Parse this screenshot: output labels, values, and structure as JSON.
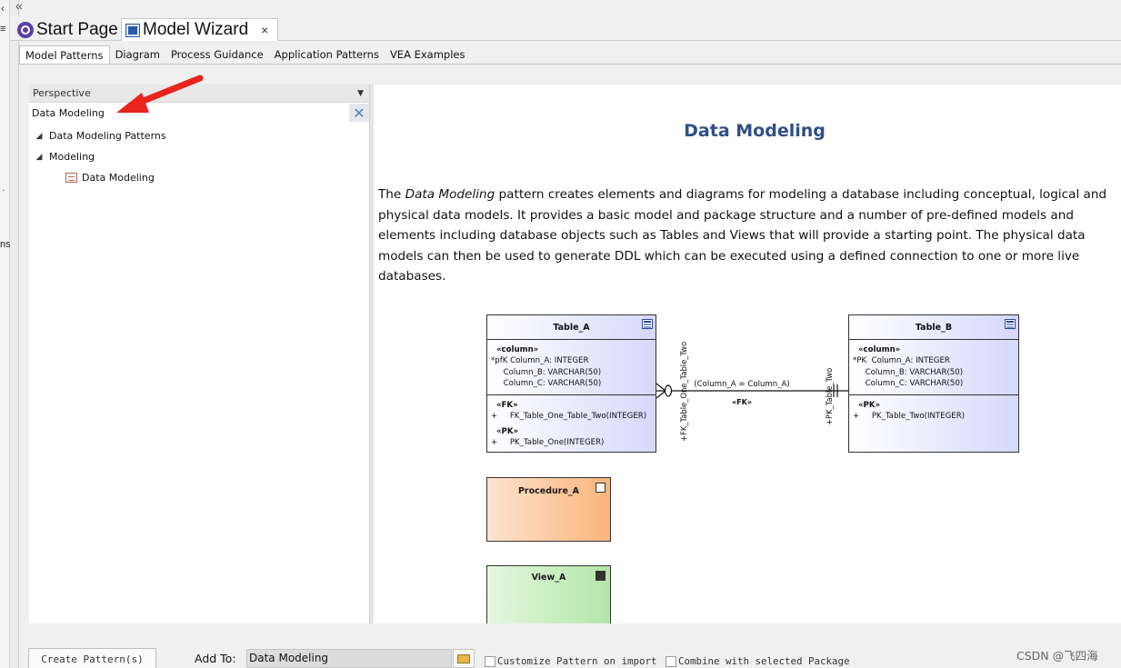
{
  "left_strip": {
    "chevron": "‹",
    "menu": "≡",
    "dot": "·",
    "fragment": "ns"
  },
  "topbar": {
    "collapse": "«"
  },
  "doc_tabs": {
    "start_page": "Start Page",
    "model_wizard": "Model Wizard",
    "close": "×"
  },
  "sub_tabs": [
    "Model Patterns",
    "Diagram",
    "Process Guidance",
    "Application Patterns",
    "VEA Examples"
  ],
  "perspective": {
    "label": "Perspective",
    "caret": "▼"
  },
  "search": {
    "value": "Data Modeling",
    "clear": "✕"
  },
  "tree": {
    "items": [
      {
        "label": "Data Modeling Patterns",
        "expanded": true
      },
      {
        "label": "Modeling",
        "expanded": true
      },
      {
        "label": "Data Modeling",
        "icon": "package-icon"
      }
    ],
    "expand_glyph": "◢"
  },
  "doc": {
    "title": "Data Modeling",
    "para_prefix": "The ",
    "para_italic": "Data Modeling",
    "para_rest": " pattern creates elements and diagrams for modeling a database including conceptual, logical and physical data models. It provides a basic model and package structure and a number of pre-defined models and elements including database objects such as Tables and Views that will provide a starting point. The physical data models can then be used to generate DDL which can be executed using a defined connection to one or more live databases."
  },
  "diagram": {
    "table_a": {
      "name": "Table_A",
      "col_stereo": "«column»",
      "cols": [
        "*pfK Column_A: INTEGER",
        "     Column_B: VARCHAR(50)",
        "     Column_C: VARCHAR(50)"
      ],
      "fk_stereo": "«FK»",
      "fk_op": "+     FK_Table_One_Table_Two(INTEGER)",
      "pk_stereo": "«PK»",
      "pk_op": "+     PK_Table_One(INTEGER)"
    },
    "table_b": {
      "name": "Table_B",
      "col_stereo": "«column»",
      "cols": [
        "*PK  Column_A: INTEGER",
        "     Column_B: VARCHAR(50)",
        "     Column_C: VARCHAR(50)"
      ],
      "pk_stereo": "«PK»",
      "pk_op": "+     PK_Table_Two(INTEGER)"
    },
    "connector": {
      "label": "(Column_A = Column_A)",
      "stereo": "«FK»",
      "role_a": "+FK_Table_One_Table_Two",
      "role_b": "+PK_Table_Two"
    },
    "procedure": "Procedure_A",
    "view": "View_A"
  },
  "bottom": {
    "create_button": "Create Pattern(s)",
    "add_to_label": "Add To:",
    "add_to_value": "Data Modeling",
    "customize_label": "Customize Pattern on import",
    "combine_label": "Combine with selected Package"
  },
  "watermark": "CSDN @飞四海",
  "colors": {
    "title_blue": "#2f4f86",
    "arrow_red": "#e8241c"
  }
}
